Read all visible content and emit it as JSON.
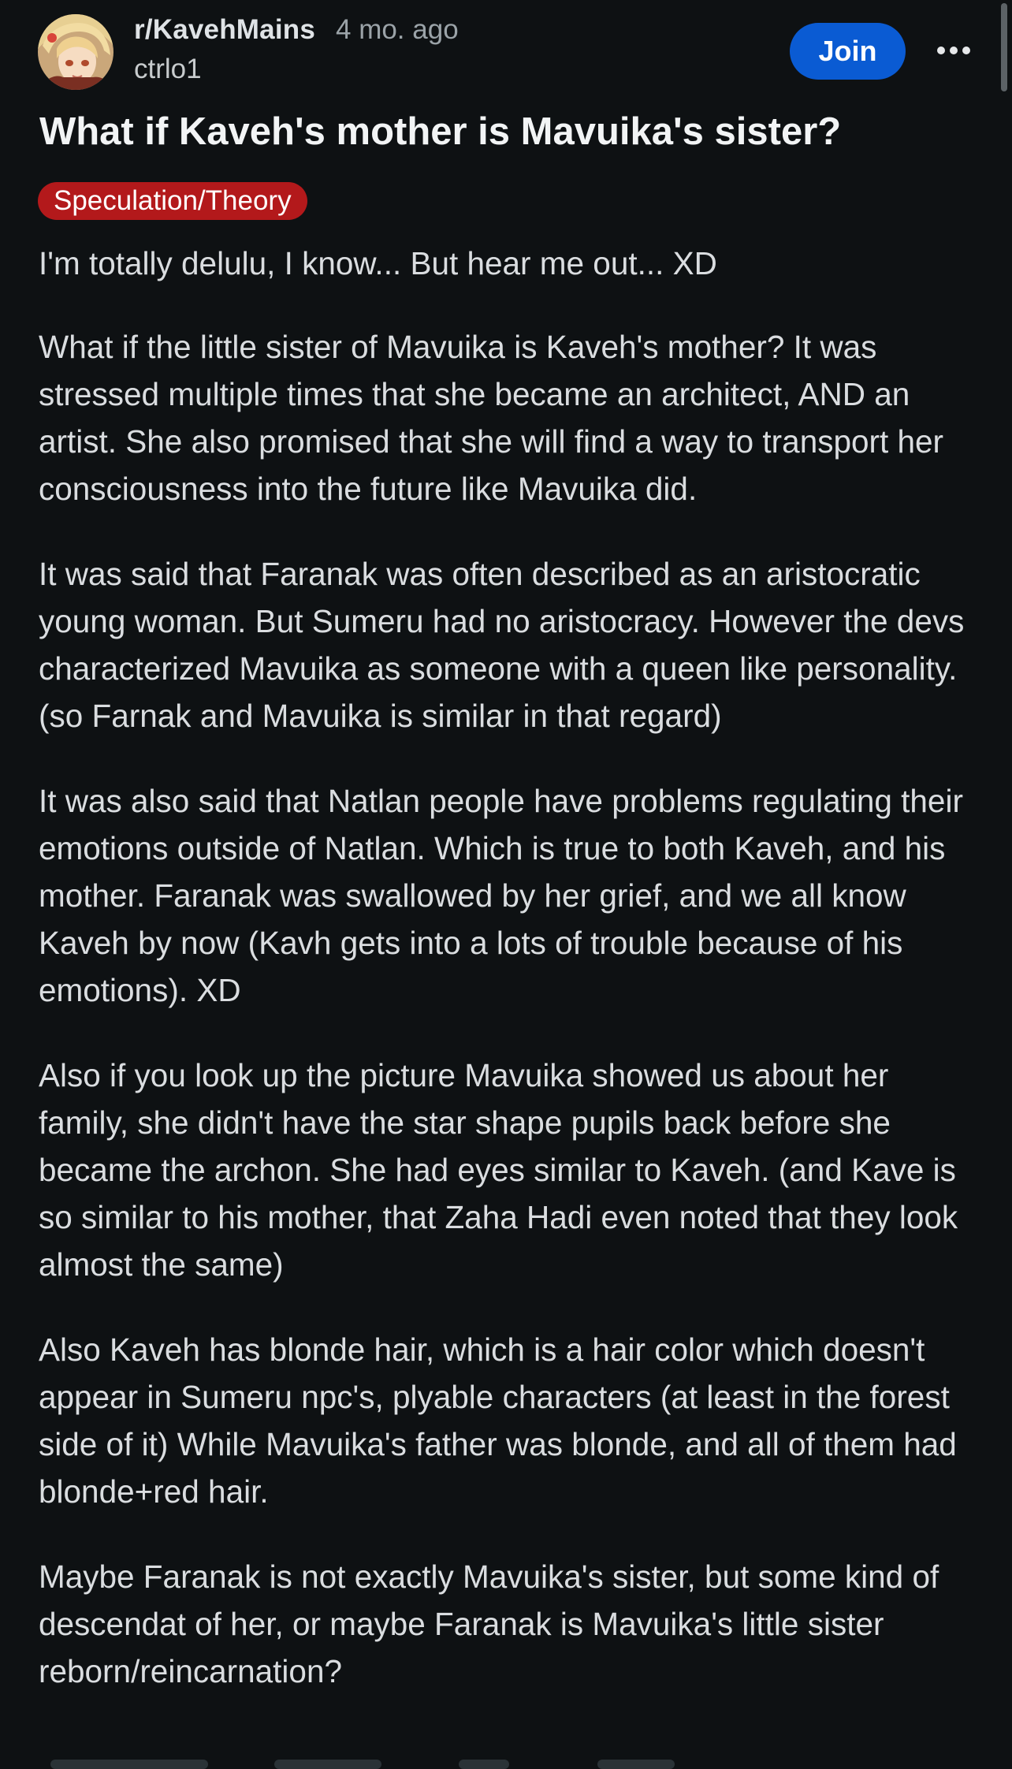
{
  "post": {
    "subreddit": "r/KavehMains",
    "time_ago": "4 mo. ago",
    "author": "ctrlo1",
    "join_label": "Join",
    "more_icon": "more-horizontal-icon",
    "title": "What if Kaveh's mother is Mavuika's sister?",
    "flair": "Speculation/Theory",
    "body": [
      "I'm totally delulu, I know... But hear me out... XD",
      "What if the little sister of Mavuika is Kaveh's mother? It was stressed multiple times that she became an architect, AND an artist. She also promised that she will find a way to transport her consciousness into the future like Mavuika did.",
      "It was said that Faranak was often described as an aristocratic young woman. But Sumeru had no aristocracy. However the devs characterized Mavuika as someone with a queen like personality. (so Farnak and Mavuika is similar in that regard)",
      "It was also said that Natlan people have problems regulating their emotions outside of Natlan. Which is true to both Kaveh, and his mother. Faranak was swallowed by her grief, and we all know Kaveh by now (Kavh gets into a lots of trouble because of his emotions). XD",
      "Also if you look up the picture Mavuika showed us about her family, she didn't have the star shape pupils back before she became the archon. She had eyes similar to Kaveh. (and Kave is so similar to his mother, that Zaha Hadi even noted that they look almost the same)",
      "Also Kaveh has blonde hair, which is a hair color which doesn't appear in Sumeru npc's, plyable characters (at least in the forest side of it) While Mavuika's father was blonde, and all of them had blonde+red hair.",
      "Maybe Faranak is not exactly Mavuika's sister, but some kind of descendat of her, or maybe Faranak is Mavuika's little sister reborn/reincarnation?"
    ]
  },
  "colors": {
    "background": "#0e1113",
    "join_button": "#0a5bd3",
    "flair": "#b3191b",
    "text": "#dadde0",
    "muted": "#9ba3a8"
  }
}
